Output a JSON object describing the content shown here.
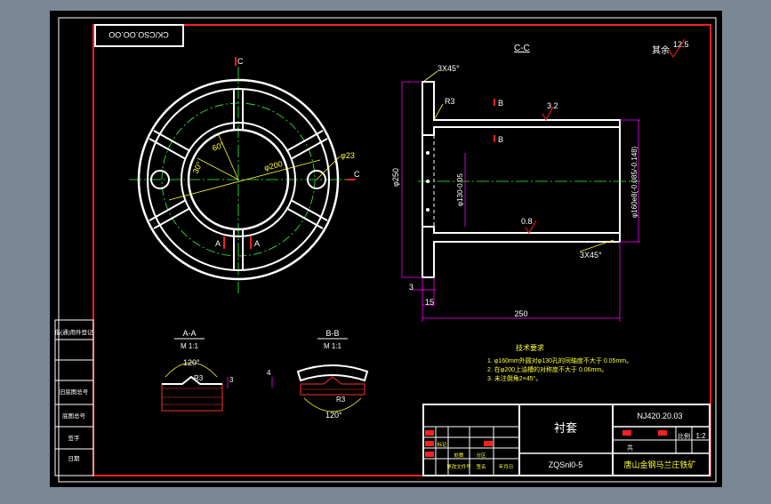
{
  "drawing": {
    "stamp_inverted": "CK/CSO.OO.OO",
    "finish_note": "其余",
    "finish_value": "12.5",
    "labels": {
      "section_cc": "C-C",
      "chamfer_top": "3X45°",
      "chamfer_bottom": "3X45°",
      "r3": "R3",
      "roughness_32": "3.2",
      "roughness_08": "0.8",
      "cut_b_top": "B",
      "cut_b_mid": "B",
      "cut_c_top": "C",
      "cut_c_right": "C",
      "cut_a_left": "A",
      "cut_a_right": "A",
      "angle_60": "60°",
      "angle_30": "30°",
      "dia_200": "φ200",
      "dia_23": "φ23",
      "dia_250": "φ250",
      "dia_inner": "φ130-0.05",
      "dia_outer": "φ160e8(-0.085/-0.148)",
      "dim_250": "250",
      "dim_3": "3",
      "dim_15": "15",
      "section_aa": "A-A",
      "scale_aa": "M 1:1",
      "section_bb": "B-B",
      "scale_bb": "M 1:1",
      "angle_120_a": "120°",
      "angle_120_b": "120°",
      "r3_a": "R3",
      "r3_b": "R3",
      "dim_3_a": "3",
      "dim_4_b": "4"
    },
    "notes": {
      "title": "技术要求",
      "line1": "1. φ160mm外圆对φ130孔的同轴度不大于 0.05mm。",
      "line2": "2. 在φ200上油槽的对称度不大于 0.06mm。",
      "line3": "3. 未注倒角2×45°。"
    },
    "left_column": [
      "借(通)用件登记",
      "旧底图总号",
      "底图总号",
      "签字",
      "日期"
    ],
    "title_block": {
      "part_name": "衬套",
      "drawing_no": "NJ420.20.03",
      "material": "ZQSnl0-5",
      "company": "唐山金钢马兰庄铁矿",
      "scale": "1:2",
      "scale_label": "比例",
      "sheet_label": "共",
      "row_labels": [
        "标记",
        "处数",
        "分区",
        "更改文件号",
        "签名",
        "年月日"
      ]
    }
  },
  "colors": {
    "background": "#000000",
    "outside": "#7a8896",
    "border": "#ff2020",
    "geometry": "#ffffff",
    "center": "#33ff33",
    "dim": "#ff00ff",
    "text": "#ffffff",
    "hatch": "#ff3030",
    "label_red": "#ff2020",
    "yellow": "#ffff33"
  }
}
